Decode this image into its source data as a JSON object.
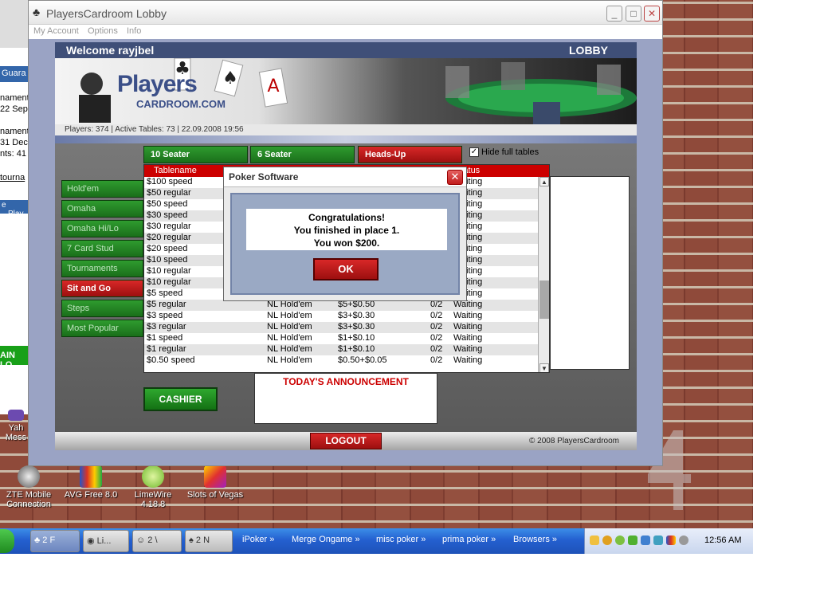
{
  "window": {
    "title": "PlayersCardroom Lobby",
    "menu": [
      "My Account",
      "Options",
      "Info"
    ]
  },
  "header": {
    "welcome": "Welcome rayjbel",
    "section": "LOBBY",
    "logo_line1": "Players",
    "logo_line2": "CARDROOM.COM"
  },
  "stats": {
    "line": "Players: 374   |   Active Tables: 73   |   22.09.2008 19:56"
  },
  "game_tabs": [
    {
      "label": "10 Seater",
      "active": false
    },
    {
      "label": "6 Seater",
      "active": false
    },
    {
      "label": "Heads-Up",
      "active": true
    }
  ],
  "hide_full": {
    "label": "Hide full tables",
    "checked": true
  },
  "side_menu": [
    {
      "label": "Hold'em",
      "active": false
    },
    {
      "label": "Omaha",
      "active": false
    },
    {
      "label": "Omaha Hi/Lo",
      "active": false
    },
    {
      "label": "7 Card Stud",
      "active": false
    },
    {
      "label": "Tournaments",
      "active": false
    },
    {
      "label": "Sit and Go",
      "active": true
    },
    {
      "label": "Steps",
      "active": false
    },
    {
      "label": "Most Popular",
      "active": false
    }
  ],
  "table": {
    "columns": [
      "Tablename",
      "Status"
    ],
    "rows": [
      {
        "name": "$100 speed",
        "game": "",
        "buyin": "",
        "players": "",
        "status": "Waiting"
      },
      {
        "name": "$50 regular",
        "game": "",
        "buyin": "",
        "players": "",
        "status": "Waiting"
      },
      {
        "name": "$50 speed",
        "game": "",
        "buyin": "",
        "players": "",
        "status": "Waiting"
      },
      {
        "name": "$30 speed",
        "game": "",
        "buyin": "",
        "players": "",
        "status": "Waiting"
      },
      {
        "name": "$30 regular",
        "game": "",
        "buyin": "",
        "players": "",
        "status": "Waiting"
      },
      {
        "name": "$20 regular",
        "game": "",
        "buyin": "",
        "players": "",
        "status": "Waiting"
      },
      {
        "name": "$20 speed",
        "game": "",
        "buyin": "",
        "players": "",
        "status": "Waiting"
      },
      {
        "name": "$10 speed",
        "game": "",
        "buyin": "",
        "players": "",
        "status": "Waiting"
      },
      {
        "name": "$10 regular",
        "game": "",
        "buyin": "",
        "players": "",
        "status": "Waiting"
      },
      {
        "name": "$10 regular",
        "game": "",
        "buyin": "",
        "players": "",
        "status": "Waiting"
      },
      {
        "name": "$5 speed",
        "game": "",
        "buyin": "",
        "players": "",
        "status": "Waiting"
      },
      {
        "name": "$5 regular",
        "game": "NL Hold'em",
        "buyin": "$5+$0.50",
        "players": "0/2",
        "status": "Waiting"
      },
      {
        "name": "$3 speed",
        "game": "NL Hold'em",
        "buyin": "$3+$0.30",
        "players": "0/2",
        "status": "Waiting"
      },
      {
        "name": "$3 regular",
        "game": "NL Hold'em",
        "buyin": "$3+$0.30",
        "players": "0/2",
        "status": "Waiting"
      },
      {
        "name": "$1 speed",
        "game": "NL Hold'em",
        "buyin": "$1+$0.10",
        "players": "0/2",
        "status": "Waiting"
      },
      {
        "name": "$1 regular",
        "game": "NL Hold'em",
        "buyin": "$1+$0.10",
        "players": "0/2",
        "status": "Waiting"
      },
      {
        "name": "$0.50 speed",
        "game": "NL Hold'em",
        "buyin": "$0.50+$0.05",
        "players": "0/2",
        "status": "Waiting"
      }
    ]
  },
  "announcement": "TODAY'S ANNOUNCEMENT",
  "cashier_label": "CASHIER",
  "logout_label": "LOGOUT",
  "copyright": "© 2008 PlayersCardroom",
  "dialog": {
    "title": "Poker Software",
    "line1": "Congratulations!",
    "line2": "You finished in place 1.",
    "line3": "You won $200.",
    "ok_label": "OK"
  },
  "bg_window": {
    "bar_text": "Guara",
    "lines": [
      "nament",
      "22 Sep",
      "nament",
      "31 Dec",
      "nts: 41",
      "tourna"
    ],
    "bar2_a": "e",
    "bar2_b": "Play",
    "green_text": "AIN LO"
  },
  "desktop_icons": [
    {
      "label": "Yah Mess"
    },
    {
      "label": "ZTE Mobile Connection"
    },
    {
      "label": "AVG Free 8.0"
    },
    {
      "label": "LimeWire 4.18.8"
    },
    {
      "label": "Slots of Vegas"
    }
  ],
  "taskbar": {
    "items": [
      "2 F",
      "Li...",
      "2 \\",
      "2 N",
      "iPoker",
      "Merge Ongame",
      "misc poker",
      "prima poker",
      "Browsers"
    ],
    "clock": "12:56 AM"
  }
}
